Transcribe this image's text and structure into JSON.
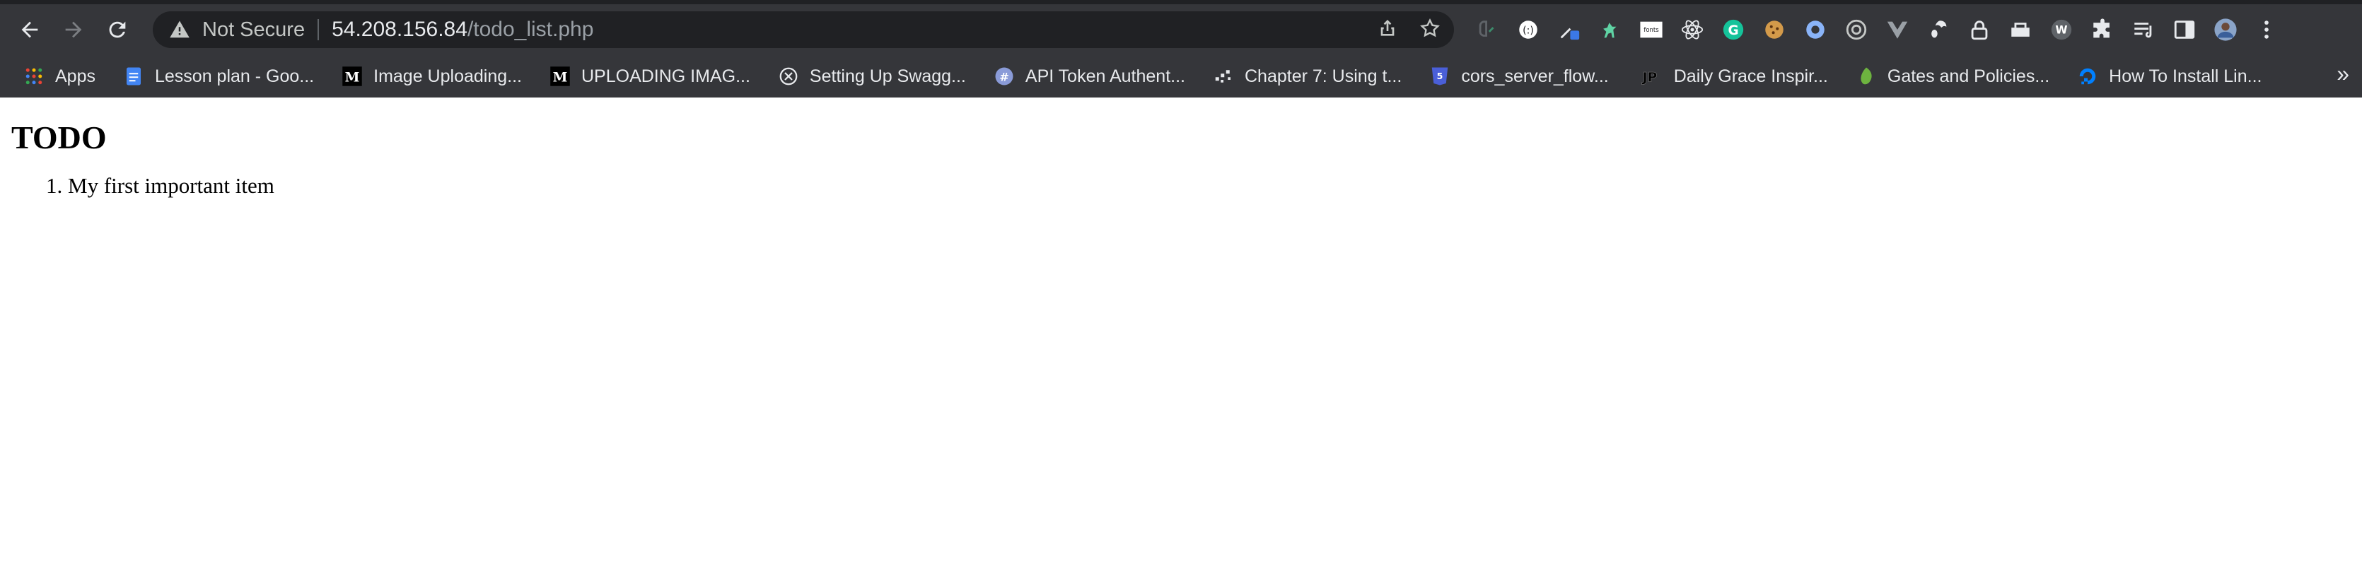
{
  "browser": {
    "address_bar": {
      "security_label": "Not Secure",
      "url_host": "54.208.156.84",
      "url_path": "/todo_list.php"
    },
    "bookmarks": [
      {
        "label": "Apps",
        "icon": "apps-grid-icon"
      },
      {
        "label": "Lesson plan - Goo...",
        "icon": "google-docs-icon"
      },
      {
        "label": "Image Uploading...",
        "icon": "medium-icon"
      },
      {
        "label": "UPLOADING IMAG...",
        "icon": "medium-icon"
      },
      {
        "label": "Setting Up Swagg...",
        "icon": "circle-x-icon"
      },
      {
        "label": "API Token Authent...",
        "icon": "hash-icon"
      },
      {
        "label": "Chapter 7: Using t...",
        "icon": "dots-icon"
      },
      {
        "label": "cors_server_flow...",
        "icon": "css-icon"
      },
      {
        "label": "Daily Grace Inspir...",
        "icon": "jp-icon"
      },
      {
        "label": "Gates and Policies...",
        "icon": "leaf-icon"
      },
      {
        "label": "How To Install Lin...",
        "icon": "digitalocean-icon"
      }
    ],
    "extensions": [
      "brain-extension-icon",
      "ublock-extension-icon",
      "eyedropper-extension-icon",
      "dinosaur-extension-icon",
      "fonts-extension-icon",
      "react-extension-icon",
      "grammarly-extension-icon",
      "cookie-extension-icon",
      "spiral-extension-icon",
      "target-extension-icon",
      "vue-extension-icon",
      "gnome-extension-icon",
      "lock-extension-icon",
      "toolbox-extension-icon",
      "wappalyzer-extension-icon",
      "puzzle-extension-icon",
      "reading-list-icon",
      "side-panel-icon",
      "profile-avatar",
      "more-menu-icon"
    ],
    "fonts_ext_label": "fonts",
    "bookmarks_overflow": "»"
  },
  "page": {
    "heading": "TODO",
    "items": [
      "My first important item"
    ]
  }
}
